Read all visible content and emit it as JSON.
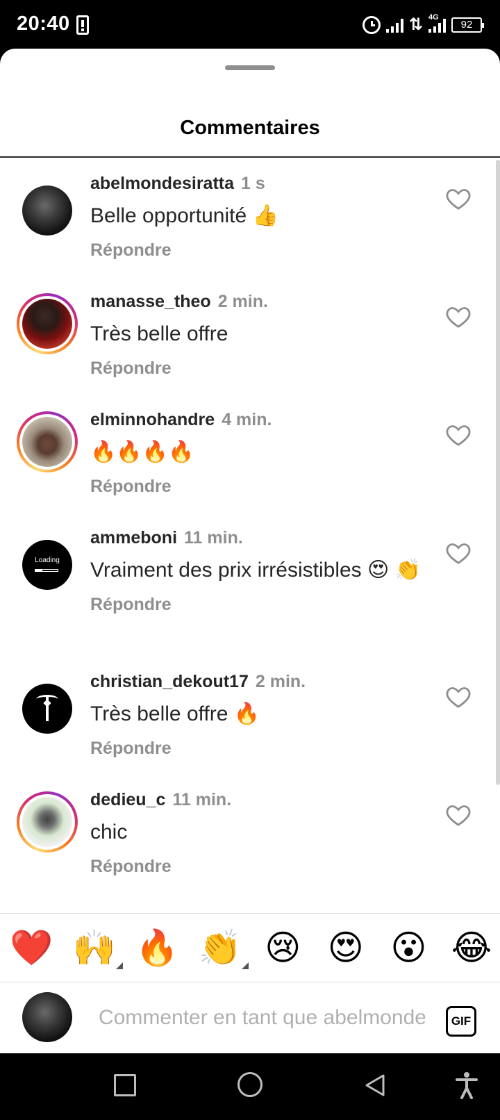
{
  "status_bar": {
    "time": "20:40",
    "network": "4G",
    "battery": "92"
  },
  "sheet": {
    "title": "Commentaires"
  },
  "comments": [
    {
      "username": "abelmondesiratta",
      "time": "1 s",
      "text": "Belle opportunité 👍",
      "reply": "Répondre",
      "avatar": "dark-profile",
      "story_ring": false
    },
    {
      "username": "manasse_theo",
      "time": "2 min.",
      "text": "Très belle offre",
      "reply": "Répondre",
      "avatar": "red-profile",
      "story_ring": true
    },
    {
      "username": "elminnohandre",
      "time": "4 min.",
      "text": "🔥🔥🔥🔥",
      "reply": "Répondre",
      "avatar": "man-profile",
      "story_ring": true
    },
    {
      "username": "ammeboni",
      "time": "11 min.",
      "text": "Vraiment des prix irrésistibles 😍 👏",
      "reply": "Répondre",
      "avatar": "loading-profile",
      "avatar_text": "Loading",
      "story_ring": false
    },
    {
      "username": "christian_dekout17",
      "time": "2 min.",
      "text": "Très belle offre 🔥",
      "reply": "Répondre",
      "avatar": "tuxedo-profile",
      "story_ring": false
    },
    {
      "username": "dedieu_c",
      "time": "11 min.",
      "text": "chic",
      "reply": "Répondre",
      "avatar": "light-profile",
      "story_ring": true
    }
  ],
  "reactions": [
    "❤️",
    "🙌",
    "🔥",
    "👏",
    "😢",
    "😍",
    "😮",
    "😂"
  ],
  "composer": {
    "placeholder": "Commenter en tant que abelmondesiratta",
    "gif_label": "GIF"
  },
  "colors": {
    "muted": "#8e8e8e",
    "text": "#262626",
    "ring_start": "#feda75",
    "ring_end": "#d62976"
  }
}
